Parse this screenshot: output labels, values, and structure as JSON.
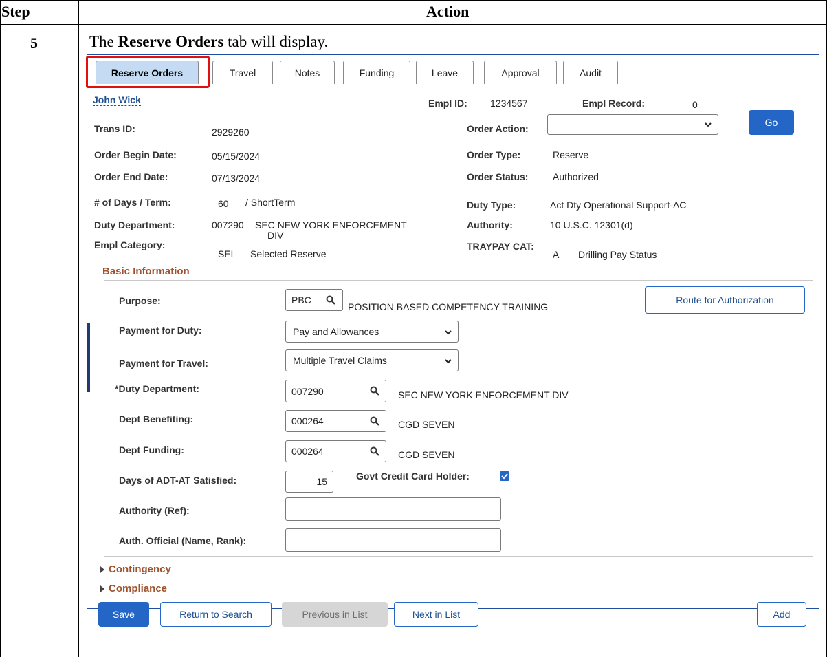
{
  "doc": {
    "col_step": "Step",
    "col_action": "Action",
    "step_number": "5",
    "intro_prefix": "The ",
    "intro_bold": "Reserve Orders",
    "intro_suffix": " tab will display."
  },
  "tabs": [
    "Reserve Orders",
    "Travel",
    "Notes",
    "Funding",
    "Leave",
    "Approval",
    "Audit"
  ],
  "header": {
    "employee_name": "John Wick",
    "empl_id_label": "Empl ID:",
    "empl_id": "1234567",
    "empl_record_label": "Empl Record:",
    "empl_record": "0",
    "trans_id_label": "Trans ID:",
    "trans_id": "2929260",
    "order_action_label": "Order Action:",
    "order_action_value": "",
    "go_label": "Go",
    "order_begin_label": "Order Begin Date:",
    "order_begin": "05/15/2024",
    "order_type_label": "Order Type:",
    "order_type": "Reserve",
    "order_end_label": "Order End Date:",
    "order_end": "07/13/2024",
    "order_status_label": "Order Status:",
    "order_status": "Authorized",
    "days_term_label": "# of Days / Term:",
    "days": "60",
    "term": "/  ShortTerm",
    "duty_type_label": "Duty Type:",
    "duty_type": "Act Dty Operational Support-AC",
    "duty_dept_label": "Duty Department:",
    "duty_dept_code": "007290",
    "duty_dept_name_1": "SEC NEW YORK ENFORCEMENT",
    "duty_dept_name_2": "DIV",
    "authority_label": "Authority:",
    "authority": "10 U.S.C. 12301(d)",
    "empl_category_label": "Empl Category:",
    "empl_category_code": "SEL",
    "empl_category_name": "Selected Reserve",
    "traypay_label": "TRAYPAY CAT:",
    "traypay_code": "A",
    "traypay_name": "Drilling Pay Status"
  },
  "basic": {
    "title": "Basic Information",
    "purpose_label": "Purpose:",
    "purpose_code": "PBC",
    "purpose_desc": "POSITION BASED COMPETENCY TRAINING",
    "route_button": "Route for Authorization",
    "payment_duty_label": "Payment for Duty:",
    "payment_duty": "Pay and Allowances",
    "payment_travel_label": "Payment for Travel:",
    "payment_travel": "Multiple Travel Claims",
    "duty_dept_label": "*Duty Department:",
    "duty_dept_code": "007290",
    "duty_dept_desc": "SEC NEW YORK ENFORCEMENT DIV",
    "dept_benefiting_label": "Dept Benefiting:",
    "dept_benefiting_code": "000264",
    "dept_benefiting_desc": "CGD SEVEN",
    "dept_funding_label": "Dept Funding:",
    "dept_funding_code": "000264",
    "dept_funding_desc": "CGD SEVEN",
    "days_adt_label": "Days of ADT-AT Satisfied:",
    "days_adt": "15",
    "govt_cc_label": "Govt Credit Card Holder:",
    "govt_cc_checked": true,
    "authority_ref_label": "Authority (Ref):",
    "authority_ref": "",
    "auth_official_label": "Auth. Official (Name, Rank):",
    "auth_official": ""
  },
  "collapsibles": [
    "Contingency",
    "Compliance"
  ],
  "footer": {
    "save": "Save",
    "return": "Return to Search",
    "previous": "Previous in List",
    "next": "Next in List",
    "add": "Add"
  },
  "colors": {
    "accent": "#2466c6",
    "highlight": "#e01010",
    "section": "#a0522d",
    "active_tab": "#c5dbf3"
  }
}
